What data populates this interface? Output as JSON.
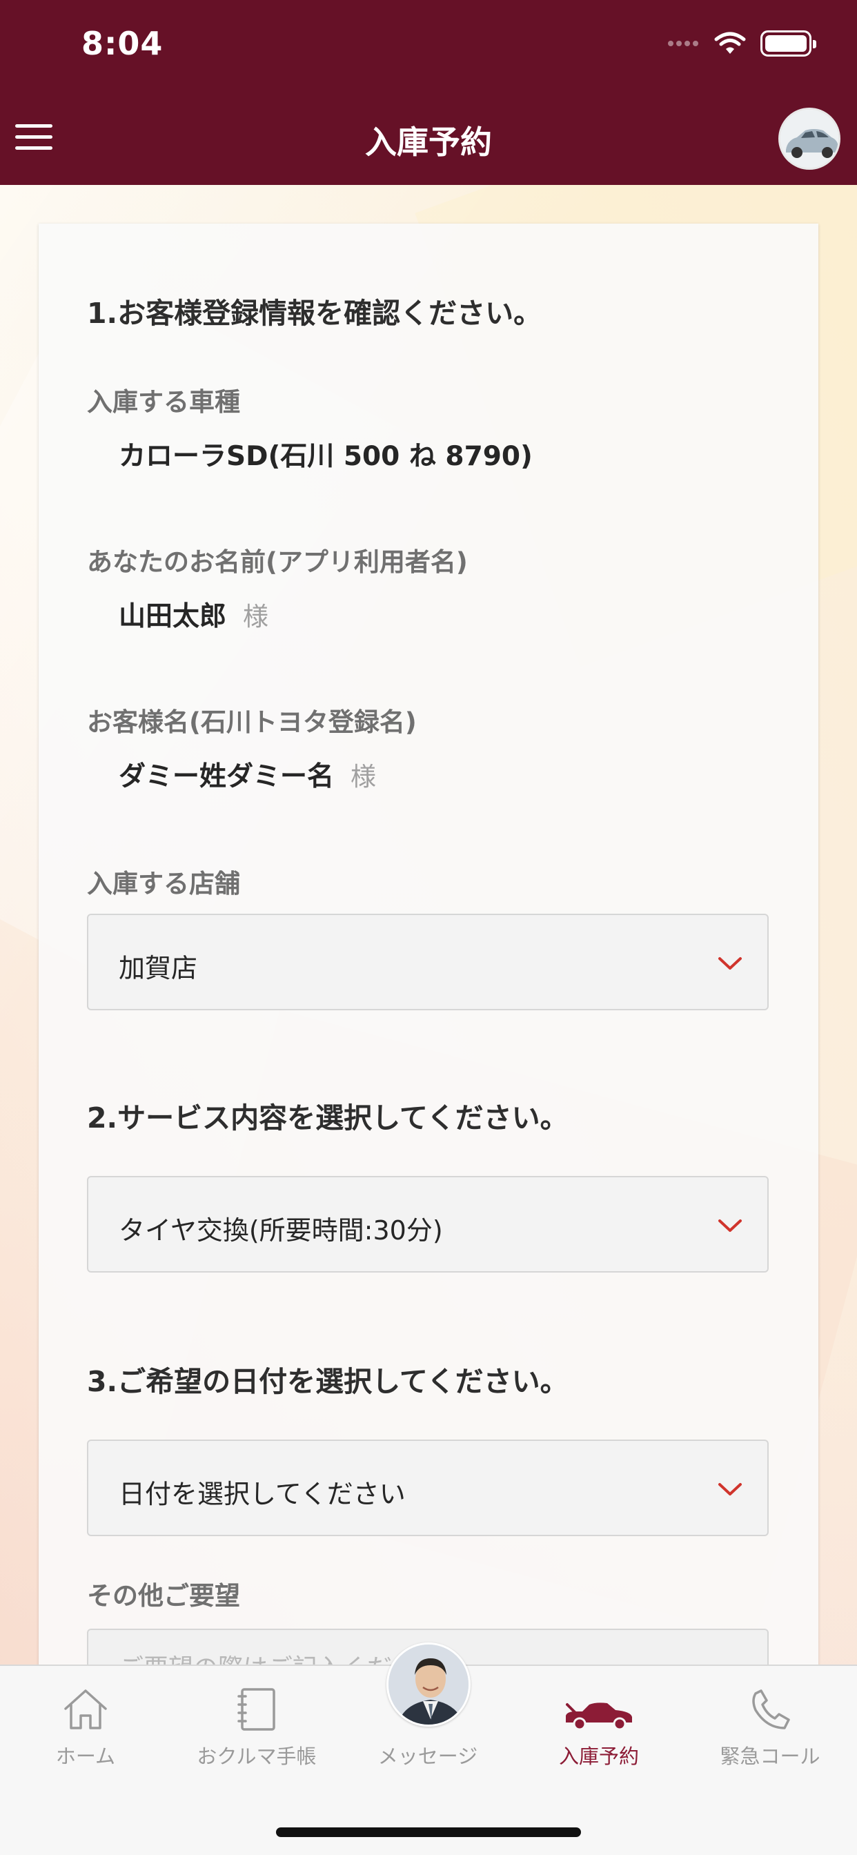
{
  "status_bar": {
    "time": "8:04"
  },
  "header": {
    "title": "入庫予約"
  },
  "form": {
    "section1_heading": "1.お客様登録情報を確認ください。",
    "vehicle_label": "入庫する車種",
    "vehicle_value": "カローラSD(石川 500 ね 8790)",
    "user_name_label": "あなたのお名前(アプリ利用者名)",
    "user_name_value": "山田太郎",
    "honorific": "様",
    "customer_name_label": "お客様名(石川トヨタ登録名)",
    "customer_name_value": "ダミー姓ダミー名",
    "store_label": "入庫する店舗",
    "store_selected": "加賀店",
    "section2_heading": "2.サービス内容を選択してください。",
    "service_selected": "タイヤ交換(所要時間:30分)",
    "section3_heading": "3.ご希望の日付を選択してください。",
    "date_placeholder": "日付を選択してください",
    "other_requests_label": "その他ご要望",
    "other_requests_placeholder": "ご要望の際はご記入ください"
  },
  "tab_bar": {
    "tabs": [
      {
        "label": "ホーム",
        "icon": "home-icon"
      },
      {
        "label": "おクルマ手帳",
        "icon": "notebook-icon"
      },
      {
        "label": "メッセージ",
        "icon": "staff-avatar"
      },
      {
        "label": "入庫予約",
        "icon": "car-icon"
      },
      {
        "label": "緊急コール",
        "icon": "phone-icon"
      }
    ],
    "active_index": 3
  },
  "colors": {
    "brand": "#661127",
    "accent_active": "#8c1c36",
    "chevron": "#d0342c"
  }
}
